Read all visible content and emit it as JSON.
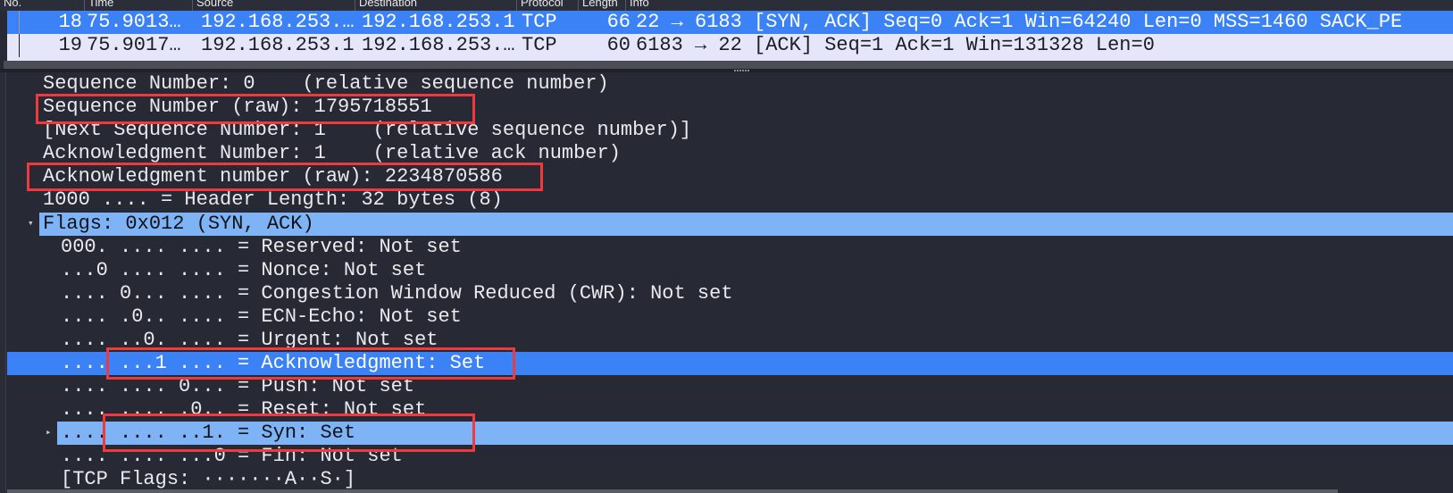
{
  "packet_list": {
    "columns": [
      "No.",
      "Time",
      "Source",
      "Destination",
      "Protocol",
      "Length",
      "Info"
    ],
    "rows": [
      {
        "no": "18",
        "time": "75.9013…",
        "source": "192.168.253.…",
        "destination": "192.168.253.1",
        "protocol": "TCP",
        "length": "66",
        "info": "22 → 6183 [SYN, ACK] Seq=0 Ack=1 Win=64240 Len=0 MSS=1460 SACK_PE",
        "selected": true
      },
      {
        "no": "19",
        "time": "75.9017…",
        "source": "192.168.253.1",
        "destination": "192.168.253.…",
        "protocol": "TCP",
        "length": "60",
        "info": "6183 → 22 [ACK] Seq=1 Ack=1 Win=131328 Len=0",
        "selected": false
      }
    ]
  },
  "details": {
    "lines": [
      "Sequence Number: 0    (relative sequence number)",
      "Sequence Number (raw): 1795718551",
      "[Next Sequence Number: 1    (relative sequence number)]",
      "Acknowledgment Number: 1    (relative ack number)",
      "Acknowledgment number (raw): 2234870586",
      "1000 .... = Header Length: 32 bytes (8)",
      "Flags: 0x012 (SYN, ACK)"
    ],
    "flag_lines": [
      "000. .... .... = Reserved: Not set",
      "...0 .... .... = Nonce: Not set",
      ".... 0... .... = Congestion Window Reduced (CWR): Not set",
      ".... .0.. .... = ECN-Echo: Not set",
      ".... ..0. .... = Urgent: Not set",
      ".... ...1 .... = Acknowledgment: Set",
      ".... .... 0... = Push: Not set",
      ".... .... .0.. = Reset: Not set",
      ".... .... ..1. = Syn: Set",
      ".... .... ...0 = Fin: Not set",
      "[TCP Flags: ·······A··S·]"
    ]
  },
  "colors": {
    "selection_strong": "#3b82f6",
    "selection_light": "#7eb4f6",
    "annotation_box": "#ee3a3f",
    "background": "#272934"
  }
}
